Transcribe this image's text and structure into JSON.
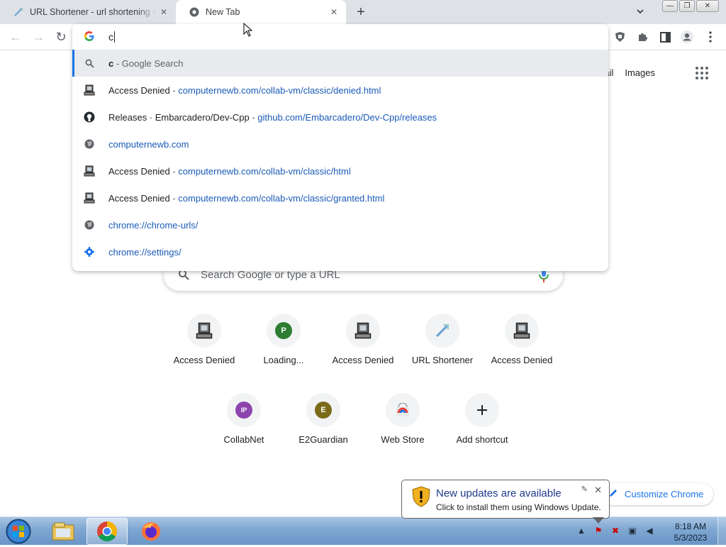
{
  "tabs": [
    {
      "title": "URL Shortener - url shortening se",
      "close": "✕"
    },
    {
      "title": "New Tab",
      "close": "✕"
    }
  ],
  "window_controls": {
    "minimize": "—",
    "maximize": "❐",
    "close": "✕"
  },
  "omnibox": {
    "typed": "c",
    "suggestions": [
      {
        "icon": "search-icon",
        "title": "c",
        "sep": " - ",
        "url": "Google Search"
      },
      {
        "icon": "computer-favicon",
        "title": "Access Denied",
        "sep": " - ",
        "url": "computernewb.com/collab-vm/classic/denied.html"
      },
      {
        "icon": "github-icon",
        "title": "Releases · Embarcadero/Dev-Cpp",
        "sep": " - ",
        "url": "github.com/Embarcadero/Dev-Cpp/releases"
      },
      {
        "icon": "globe-icon",
        "title": "",
        "sep": "",
        "url": "computernewb.com"
      },
      {
        "icon": "computer-favicon",
        "title": "Access Denied",
        "sep": " - ",
        "url": "computernewb.com/collab-vm/classic/html"
      },
      {
        "icon": "computer-favicon",
        "title": "Access Denied",
        "sep": " - ",
        "url": "computernewb.com/collab-vm/classic/granted.html"
      },
      {
        "icon": "globe-icon",
        "title": "",
        "sep": "",
        "url": "chrome://chrome-urls/"
      },
      {
        "icon": "gear-icon",
        "title": "",
        "sep": "",
        "url": "chrome://settings/"
      }
    ]
  },
  "header_links": {
    "gmail": "Gmail",
    "images": "Images"
  },
  "search": {
    "placeholder": "Search Google or type a URL"
  },
  "shortcuts": [
    {
      "label": "Access Denied",
      "icon": "computer-favicon"
    },
    {
      "label": "Loading...",
      "letter": "P",
      "color": "#2e7d32"
    },
    {
      "label": "Access Denied",
      "icon": "computer-favicon"
    },
    {
      "label": "URL Shortener",
      "icon": "link-favicon"
    },
    {
      "label": "Access Denied",
      "icon": "computer-favicon"
    },
    {
      "label": "CollabNet",
      "letter": "IP",
      "color": "#8e44ad"
    },
    {
      "label": "E2Guardian",
      "letter": "E",
      "color": "#7a6a1a"
    },
    {
      "label": "Web Store",
      "icon": "webstore-icon"
    },
    {
      "label": "Add shortcut",
      "icon": "plus-icon"
    }
  ],
  "customize": {
    "label": "Customize Chrome"
  },
  "notification": {
    "title": "New updates are available",
    "body": "Click to install them using Windows Update."
  },
  "clock": {
    "time": "8:18 AM",
    "date": "5/3/2023"
  }
}
